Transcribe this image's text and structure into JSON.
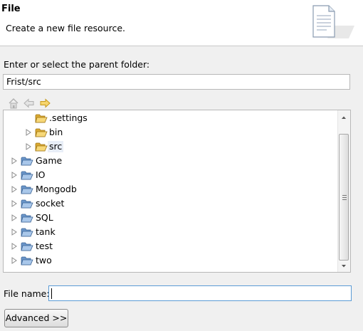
{
  "banner": {
    "title": "File",
    "description": "Create a new file resource.",
    "icon": "new-file-wizard-icon"
  },
  "parent_folder": {
    "label": "Enter or select the parent folder:",
    "value": "Frist/src"
  },
  "toolbar": {
    "icons": [
      "home-icon",
      "back-icon",
      "forward-icon"
    ]
  },
  "tree": {
    "items": [
      {
        "label": ".settings",
        "expandable": false
      },
      {
        "label": "bin",
        "expandable": true
      },
      {
        "label": "src",
        "expandable": true,
        "selected": true
      },
      {
        "label": "Game",
        "expandable": true
      },
      {
        "label": "IO",
        "expandable": true
      },
      {
        "label": "Mongodb",
        "expandable": true
      },
      {
        "label": "socket",
        "expandable": true
      },
      {
        "label": "SQL",
        "expandable": true
      },
      {
        "label": "tank",
        "expandable": true
      },
      {
        "label": "test",
        "expandable": true
      },
      {
        "label": "two",
        "expandable": true
      }
    ]
  },
  "file_name": {
    "label": "File name:",
    "value": ""
  },
  "buttons": {
    "advanced": "Advanced >>"
  },
  "colors": {
    "folder": "#e9c46a",
    "selection": "#e8eef7",
    "focus_border": "#5b9bd5"
  }
}
